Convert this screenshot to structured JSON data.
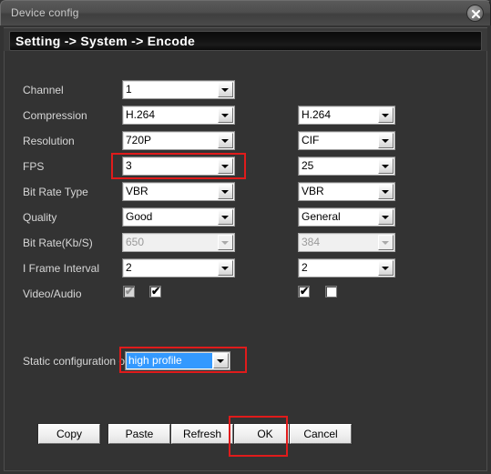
{
  "window": {
    "title": "Device config",
    "close_icon": "close-icon"
  },
  "header": {
    "breadcrumb": "Setting -> System -> Encode"
  },
  "form": {
    "labels": {
      "channel": "Channel",
      "compression": "Compression",
      "resolution": "Resolution",
      "fps": "FPS",
      "bit_rate_type": "Bit Rate Type",
      "quality": "Quality",
      "bit_rate": "Bit Rate(Kb/S)",
      "i_frame_interval": "I Frame Interval",
      "video_audio": "Video/Audio",
      "static_configuration": "Static configuration of"
    },
    "main_stream": {
      "channel": "1",
      "compression": "H.264",
      "resolution": "720P",
      "fps": "3",
      "bit_rate_type": "VBR",
      "quality": "Good",
      "bit_rate": "650",
      "i_frame_interval": "2",
      "video_checked": true,
      "video_enabled": false,
      "audio_checked": true,
      "audio_enabled": true
    },
    "sub_stream": {
      "compression": "H.264",
      "resolution": "CIF",
      "fps": "25",
      "bit_rate_type": "VBR",
      "quality": "General",
      "bit_rate": "384",
      "i_frame_interval": "2",
      "video_checked": true,
      "video_enabled": true,
      "audio_checked": false,
      "audio_enabled": true
    },
    "static_configuration_value": "high profile"
  },
  "buttons": {
    "copy": "Copy",
    "paste": "Paste",
    "refresh": "Refresh",
    "ok": "OK",
    "cancel": "Cancel"
  },
  "highlights": {
    "color": "#e01b1b",
    "targets": [
      "fps-field",
      "static-configuration-field",
      "ok-button"
    ]
  }
}
